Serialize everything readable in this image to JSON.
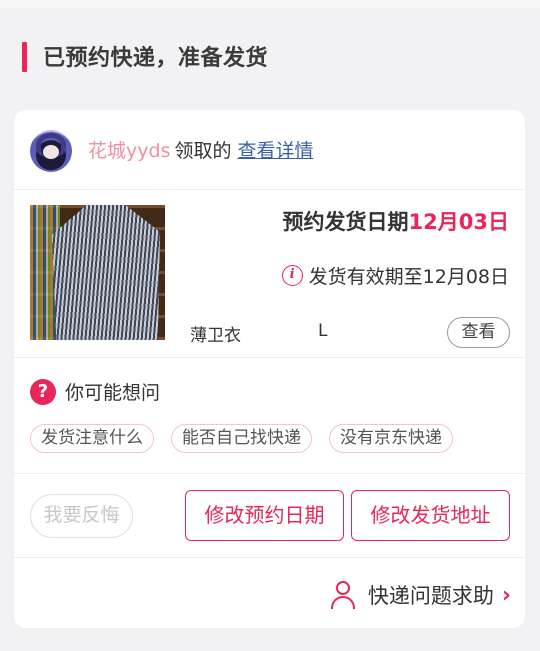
{
  "header": {
    "title": "已预约快递，准备发货"
  },
  "user": {
    "name": "花城yyds",
    "action_text": "领取的",
    "detail_link": "查看详情"
  },
  "item": {
    "schedule_label": "预约发货日期",
    "schedule_date": "12月03日",
    "validity_text": "发货有效期至12月08日",
    "name": "薄卫衣",
    "size": "L",
    "view_button": "查看"
  },
  "faq": {
    "title": "你可能想问",
    "chips": [
      "发货注意什么",
      "能否自己找快递",
      "没有京东快递"
    ]
  },
  "actions": {
    "regret": "我要反悔",
    "change_date": "修改预约日期",
    "change_address": "修改发货地址"
  },
  "help": {
    "label": "快递问题求助"
  },
  "colors": {
    "accent": "#e8265a",
    "link": "#3d5fa8",
    "username": "#f08fa0"
  },
  "icons": {
    "info": "info-icon",
    "question": "question-icon",
    "person": "person-icon",
    "chevron": "chevron-right-icon"
  }
}
